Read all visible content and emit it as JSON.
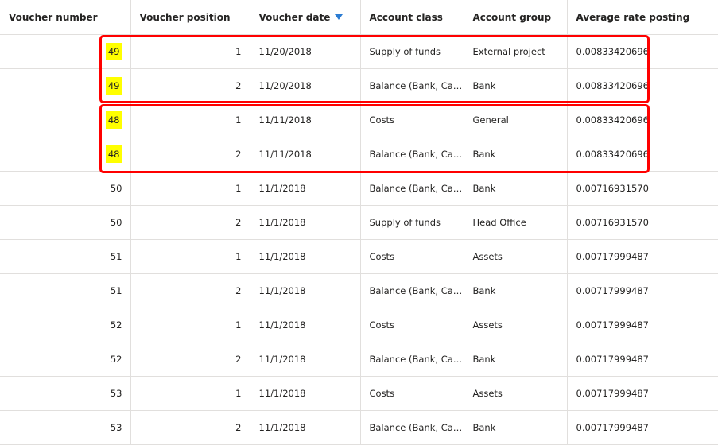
{
  "columns": [
    "Voucher number",
    "Voucher position",
    "Voucher date",
    "Account class",
    "Account group",
    "Average rate posting"
  ],
  "sort_icon": "sort-descending-icon",
  "highlight_color": "#ffff00",
  "box_color": "#ff0000",
  "rows": [
    [
      "49",
      "1",
      "11/20/2018",
      "Supply of funds",
      "External project",
      "0.00833420696"
    ],
    [
      "49",
      "2",
      "11/20/2018",
      "Balance (Bank, Cas...",
      "Bank",
      "0.00833420696"
    ],
    [
      "48",
      "1",
      "11/11/2018",
      "Costs",
      "General",
      "0.00833420696"
    ],
    [
      "48",
      "2",
      "11/11/2018",
      "Balance (Bank, Cas...",
      "Bank",
      "0.00833420696"
    ],
    [
      "50",
      "1",
      "11/1/2018",
      "Balance (Bank, Cas...",
      "Bank",
      "0.00716931570"
    ],
    [
      "50",
      "2",
      "11/1/2018",
      "Supply of funds",
      "Head Office",
      "0.00716931570"
    ],
    [
      "51",
      "1",
      "11/1/2018",
      "Costs",
      "Assets",
      "0.00717999487"
    ],
    [
      "51",
      "2",
      "11/1/2018",
      "Balance (Bank, Cas...",
      "Bank",
      "0.00717999487"
    ],
    [
      "52",
      "1",
      "11/1/2018",
      "Costs",
      "Assets",
      "0.00717999487"
    ],
    [
      "52",
      "2",
      "11/1/2018",
      "Balance (Bank, Cas...",
      "Bank",
      "0.00717999487"
    ],
    [
      "53",
      "1",
      "11/1/2018",
      "Costs",
      "Assets",
      "0.00717999487"
    ],
    [
      "53",
      "2",
      "11/1/2018",
      "Balance (Bank, Cas...",
      "Bank",
      "0.00717999487"
    ]
  ]
}
